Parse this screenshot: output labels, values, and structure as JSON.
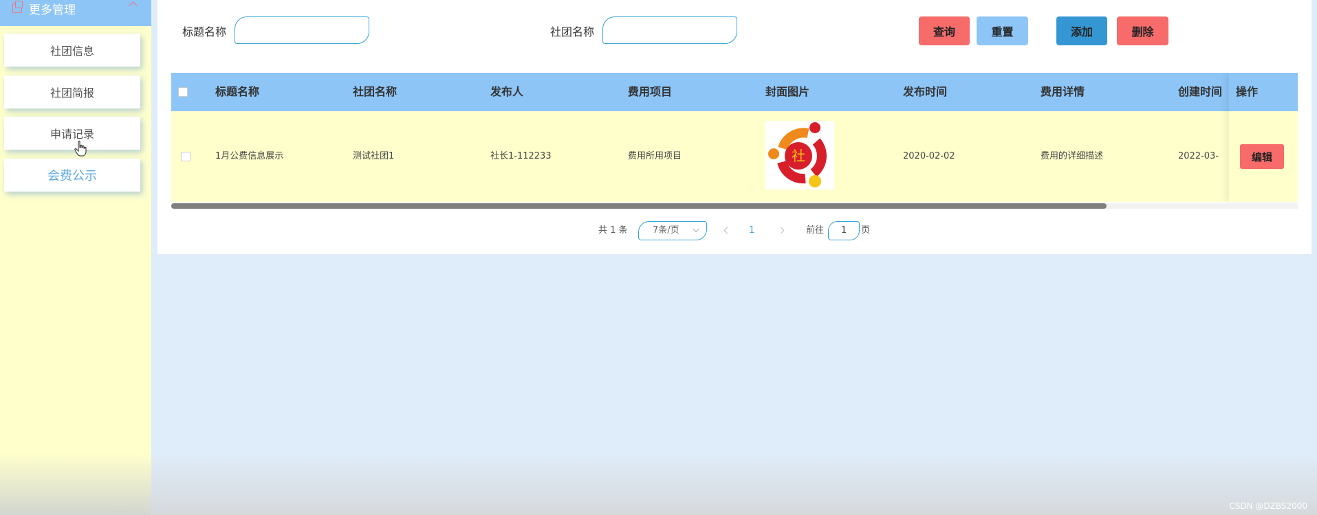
{
  "sidebar": {
    "header_label": "更多管理",
    "items": [
      {
        "label": "社团信息"
      },
      {
        "label": "社团简报"
      },
      {
        "label": "申请记录"
      },
      {
        "label": "会费公示"
      }
    ],
    "active_item": "会费公示"
  },
  "search": {
    "title_label": "标题名称",
    "title_value": "",
    "club_label": "社团名称",
    "club_value": ""
  },
  "toolbar": {
    "query": "查询",
    "reset": "重置",
    "add": "添加",
    "delete": "删除"
  },
  "table": {
    "columns": [
      "标题名称",
      "社团名称",
      "发布人",
      "费用项目",
      "封面图片",
      "发布时间",
      "费用详情",
      "创建时间"
    ],
    "action_header": "操作",
    "rows": [
      {
        "title": "1月公费信息展示",
        "club": "测试社团1",
        "publisher": "社长1-112233",
        "fee_item": "费用所用项目",
        "cover_text": "社",
        "publish_time": "2020-02-02",
        "fee_detail": "费用的详细描述",
        "create_time": "2022-03-",
        "action": "编辑"
      }
    ]
  },
  "pagination": {
    "total": "共 1 条",
    "page_size": "7条/页",
    "current_page": "1",
    "goto_label": "前往",
    "goto_value": "1",
    "page_unit": "页"
  },
  "watermark": "CSDN @DZBS2000",
  "colors": {
    "sidebar_bg": "#ffffcc",
    "header_blue": "#8ec5f7",
    "accent_blue": "#34a3d8",
    "danger_red": "#f76b6b",
    "add_blue": "#3497d3",
    "page_bg": "#dfecf9"
  }
}
